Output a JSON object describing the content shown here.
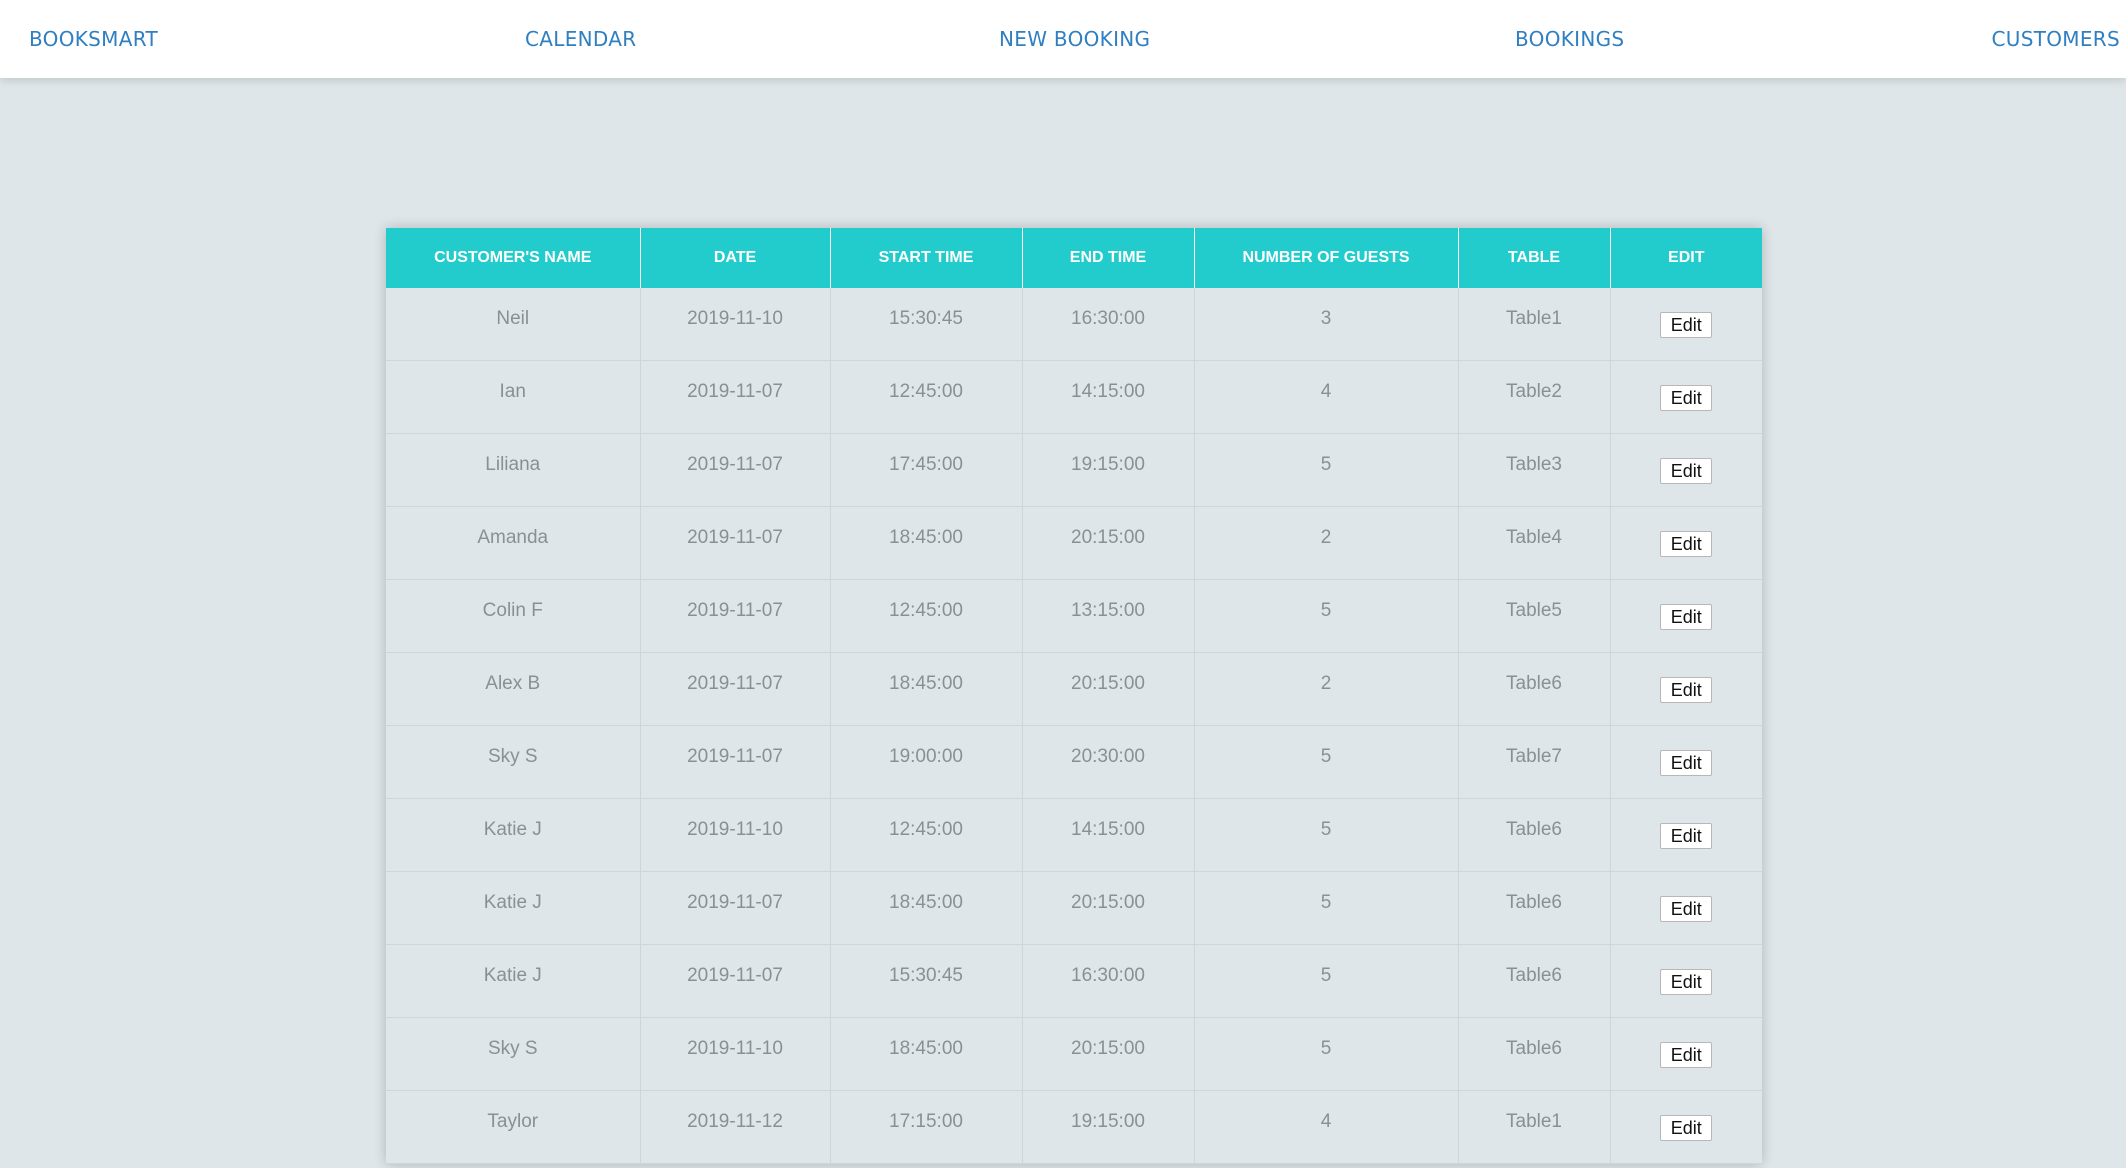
{
  "nav": {
    "brand": "BOOKSMART",
    "calendar": "CALENDAR",
    "new_booking": "NEW BOOKING",
    "bookings": "BOOKINGS",
    "customers": "CUSTOMERS"
  },
  "colors": {
    "nav_link": "#2f7fc1",
    "table_header": "#23cccc",
    "page_background": "#dfe6e9"
  },
  "table": {
    "headers": [
      "CUSTOMER'S NAME",
      "DATE",
      "START TIME",
      "END TIME",
      "NUMBER OF GUESTS",
      "TABLE",
      "EDIT"
    ],
    "edit_label": "Edit",
    "rows": [
      {
        "name": "Neil",
        "date": "2019-11-10",
        "start": "15:30:45",
        "end": "16:30:00",
        "guests": "3",
        "table": "Table1"
      },
      {
        "name": "Ian",
        "date": "2019-11-07",
        "start": "12:45:00",
        "end": "14:15:00",
        "guests": "4",
        "table": "Table2"
      },
      {
        "name": "Liliana",
        "date": "2019-11-07",
        "start": "17:45:00",
        "end": "19:15:00",
        "guests": "5",
        "table": "Table3"
      },
      {
        "name": "Amanda",
        "date": "2019-11-07",
        "start": "18:45:00",
        "end": "20:15:00",
        "guests": "2",
        "table": "Table4"
      },
      {
        "name": "Colin F",
        "date": "2019-11-07",
        "start": "12:45:00",
        "end": "13:15:00",
        "guests": "5",
        "table": "Table5"
      },
      {
        "name": "Alex B",
        "date": "2019-11-07",
        "start": "18:45:00",
        "end": "20:15:00",
        "guests": "2",
        "table": "Table6"
      },
      {
        "name": "Sky S",
        "date": "2019-11-07",
        "start": "19:00:00",
        "end": "20:30:00",
        "guests": "5",
        "table": "Table7"
      },
      {
        "name": "Katie J",
        "date": "2019-11-10",
        "start": "12:45:00",
        "end": "14:15:00",
        "guests": "5",
        "table": "Table6"
      },
      {
        "name": "Katie J",
        "date": "2019-11-07",
        "start": "18:45:00",
        "end": "20:15:00",
        "guests": "5",
        "table": "Table6"
      },
      {
        "name": "Katie J",
        "date": "2019-11-07",
        "start": "15:30:45",
        "end": "16:30:00",
        "guests": "5",
        "table": "Table6"
      },
      {
        "name": "Sky S",
        "date": "2019-11-10",
        "start": "18:45:00",
        "end": "20:15:00",
        "guests": "5",
        "table": "Table6"
      },
      {
        "name": "Taylor",
        "date": "2019-11-12",
        "start": "17:15:00",
        "end": "19:15:00",
        "guests": "4",
        "table": "Table1"
      }
    ]
  }
}
